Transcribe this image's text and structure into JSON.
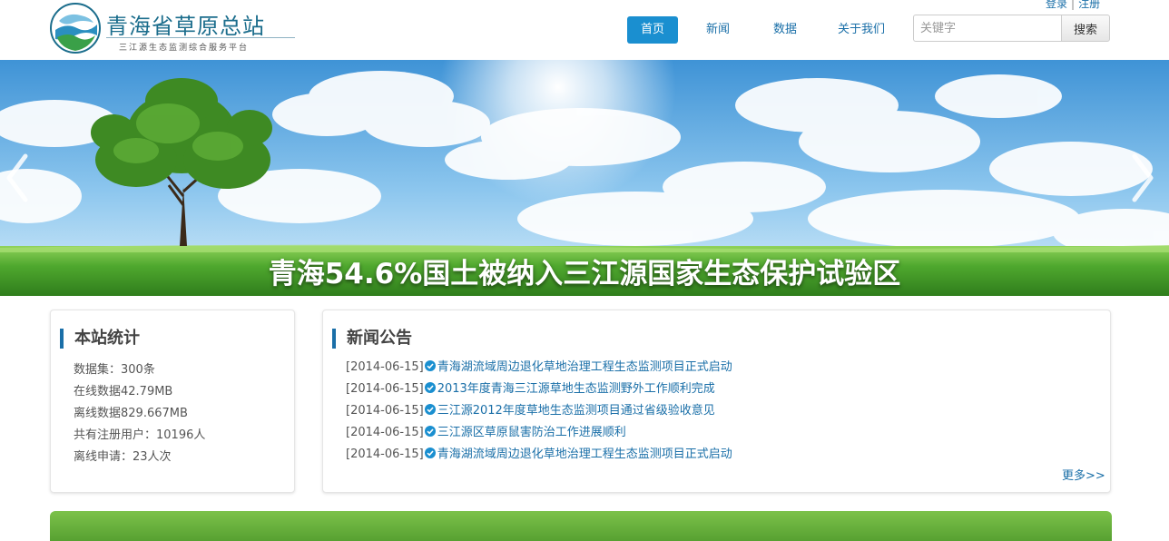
{
  "header": {
    "logo_title": "青海省草原总站",
    "logo_subtitle": "三江源生态监测综合服务平台",
    "auth": {
      "login": "登录",
      "separator": "|",
      "register": "注册"
    },
    "nav": [
      {
        "label": "首页",
        "active": true
      },
      {
        "label": "新闻",
        "active": false
      },
      {
        "label": "数据",
        "active": false
      },
      {
        "label": "关于我们",
        "active": false
      }
    ],
    "search": {
      "placeholder": "关键字",
      "value": "",
      "button_label": "搜索"
    }
  },
  "banner": {
    "caption": "青海54.6%国土被纳入三江源国家生态保护试验区",
    "prev_icon": "chevron-left-icon",
    "next_icon": "chevron-right-icon"
  },
  "stats_panel": {
    "title": "本站统计",
    "items": [
      "数据集：300条",
      "在线数据42.79MB",
      "离线数据829.667MB",
      "共有注册用户：10196人",
      "离线申请：23人次"
    ]
  },
  "news_panel": {
    "title": "新闻公告",
    "items": [
      {
        "date": "[2014-06-15]",
        "title": "青海湖流域周边退化草地治理工程生态监测项目正式启动"
      },
      {
        "date": "[2014-06-15]",
        "title": "2013年度青海三江源草地生态监测野外工作顺利完成"
      },
      {
        "date": "[2014-06-15]",
        "title": "三江源2012年度草地生态监测项目通过省级验收意见"
      },
      {
        "date": "[2014-06-15]",
        "title": "三江源区草原鼠害防治工作进展顺利"
      },
      {
        "date": "[2014-06-15]",
        "title": "青海湖流域周边退化草地治理工程生态监测项目正式启动"
      }
    ],
    "more_label": "更多>>",
    "item_icon": "check-circle-icon"
  },
  "colors": {
    "accent": "#1a8fd0",
    "link": "#1a6fa8",
    "grass": "#4f9a2c",
    "sky": "#5aa8e0"
  }
}
